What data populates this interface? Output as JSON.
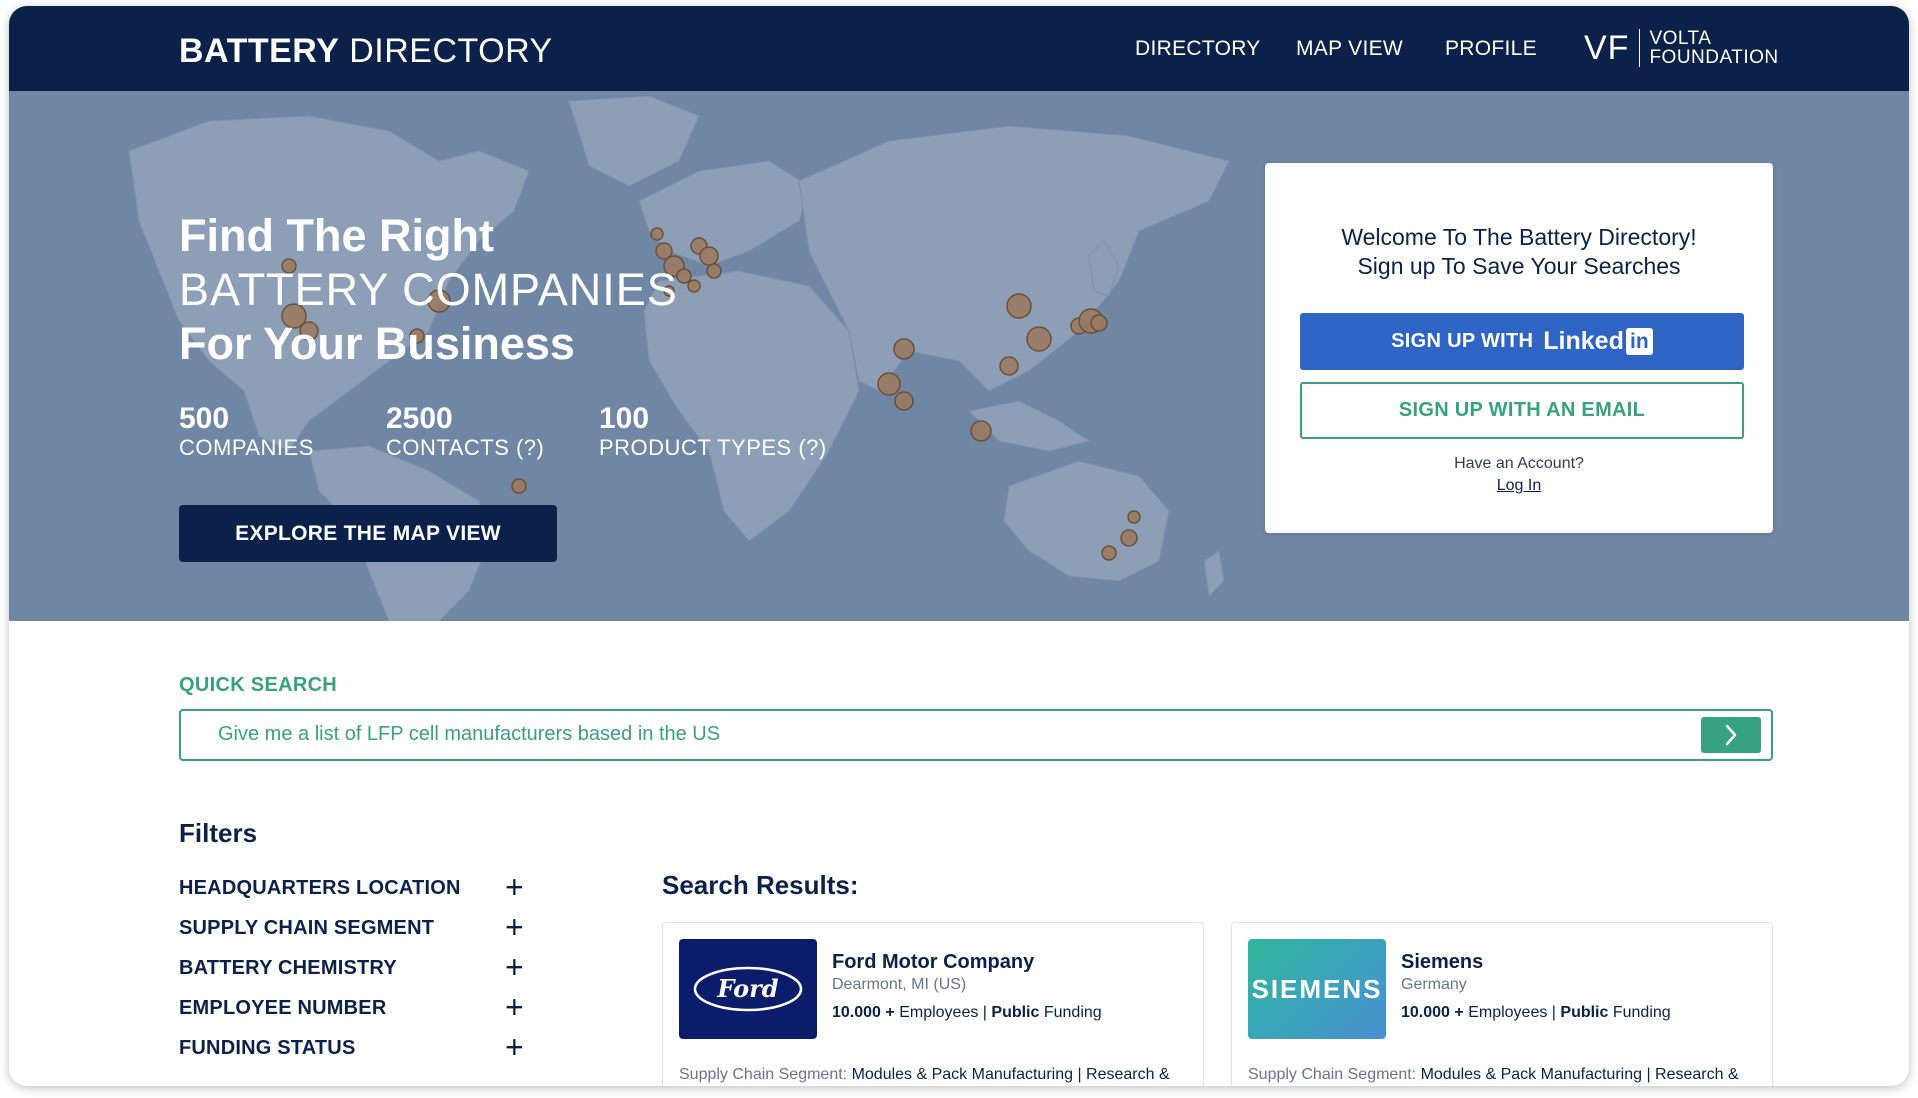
{
  "nav": {
    "brand_bold": "BATTERY",
    "brand_light": "DIRECTORY",
    "links": [
      "DIRECTORY",
      "MAP VIEW",
      "PROFILE"
    ],
    "partner_mark": "VF",
    "partner_line1": "VOLTA",
    "partner_line2": "FOUNDATION"
  },
  "hero": {
    "title_line1": "Find The Right",
    "title_line2": "BATTERY COMPANIES",
    "title_line3": "For Your Business",
    "stats": [
      {
        "value": "500",
        "label": "COMPANIES"
      },
      {
        "value": "2500",
        "label": "CONTACTS (?)"
      },
      {
        "value": "100",
        "label": "PRODUCT TYPES (?)"
      }
    ],
    "cta_label": "EXPLORE THE MAP VIEW"
  },
  "signup": {
    "welcome_line1": "Welcome To The Battery Directory!",
    "welcome_line2": "Sign up To Save Your Searches",
    "linkedin_prefix": "SIGN UP WITH",
    "linkedin_word": "Linked",
    "linkedin_badge": "in",
    "email_label": "SIGN UP WITH AN EMAIL",
    "have_account": "Have an Account?",
    "login_label": "Log In"
  },
  "quick_search": {
    "label": "QUICK SEARCH",
    "value": "Give me a list of LFP cell manufacturers based in the US"
  },
  "filters": {
    "title": "Filters",
    "items": [
      "HEADQUARTERS LOCATION",
      "SUPPLY CHAIN SEGMENT",
      "BATTERY CHEMISTRY",
      "EMPLOYEE NUMBER",
      "FUNDING STATUS"
    ]
  },
  "results": {
    "title": "Search Results:",
    "items": [
      {
        "logo_text": "Ford",
        "name": "Ford Motor Company",
        "location": "Dearmont, MI (US)",
        "employees": "10.000 +",
        "employees_label": "Employees",
        "funding": "Public",
        "funding_label": "Funding",
        "segment_label": "Supply Chain Segment:",
        "segment_value": "Modules & Pack Manufacturing | Research & Development | Modeling & Software | Legal & Financial Services"
      },
      {
        "logo_text": "SIEMENS",
        "name": "Siemens",
        "location": "Germany",
        "employees": "10.000 +",
        "employees_label": "Employees",
        "funding": "Public",
        "funding_label": "Funding",
        "segment_label": "Supply Chain Segment:",
        "segment_value": "Modules & Pack Manufacturing | Research & Development | Modeling & Software | Legal & Financial Services"
      }
    ]
  },
  "colors": {
    "navy": "#0b2149",
    "hero_bg": "#6f86a4",
    "land": "#8d9fb6",
    "marker": "#9a7a62",
    "green": "#38a17f",
    "linkedin_blue": "#2e64c4"
  }
}
